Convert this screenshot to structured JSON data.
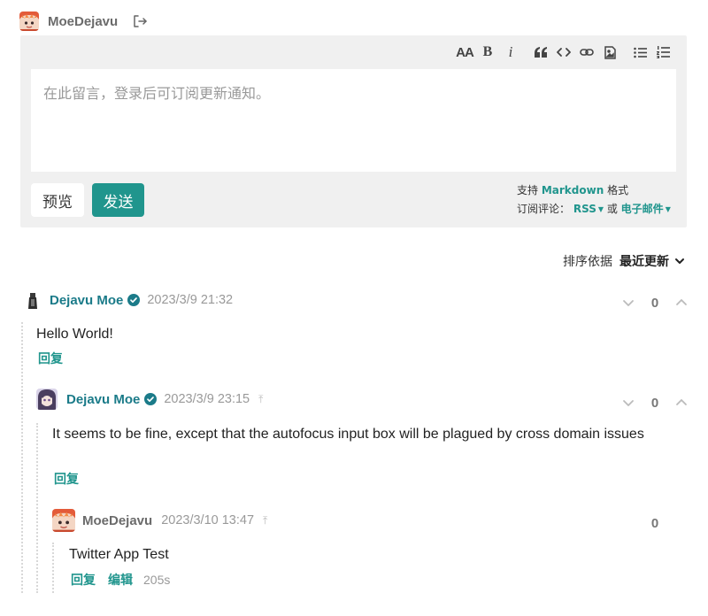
{
  "login": {
    "username": "MoeDejavu",
    "avatar_icon": "anime-avatar-icon",
    "logout_icon": "logout-icon"
  },
  "editor": {
    "placeholder": "在此留言，登录后可订阅更新通知。",
    "toolbar": {
      "heading": "AA",
      "bold": "B",
      "italic": "i",
      "quote": "“",
      "code_icon": "code-icon",
      "link_icon": "link-icon",
      "image_icon": "image-icon",
      "ul_icon": "unordered-list-icon",
      "ol_icon": "ordered-list-icon"
    },
    "preview_label": "预览",
    "send_label": "发送",
    "support_prefix": "支持",
    "support_markdown": "Markdown",
    "support_suffix": "格式",
    "subscribe_label": "订阅评论：",
    "subscribe_rss": "RSS",
    "subscribe_or": "或",
    "subscribe_email": "电子邮件"
  },
  "sort": {
    "label": "排序依据",
    "value": "最近更新"
  },
  "comments": [
    {
      "author": "Dejavu Moe",
      "verified": true,
      "time": "2023/3/9 21:32",
      "body": "Hello World!",
      "reply": "回复",
      "votes": "0"
    },
    {
      "author": "Dejavu Moe",
      "verified": true,
      "time": "2023/3/9 23:15",
      "goto_parent": "⤒",
      "body": "It seems to be fine, except that the autofocus input box will be plagued by cross domain issues",
      "reply": "回复",
      "votes": "0"
    },
    {
      "author": "MoeDejavu",
      "verified": false,
      "time": "2023/3/10 13:47",
      "goto_parent": "⤒",
      "body": "Twitter App Test",
      "reply": "回复",
      "edit": "编辑",
      "elapsed": "205s",
      "votes": "0"
    }
  ],
  "colors": {
    "accent": "#20958d",
    "author": "#1b7b89",
    "editor_bg": "#f0f0f0"
  }
}
